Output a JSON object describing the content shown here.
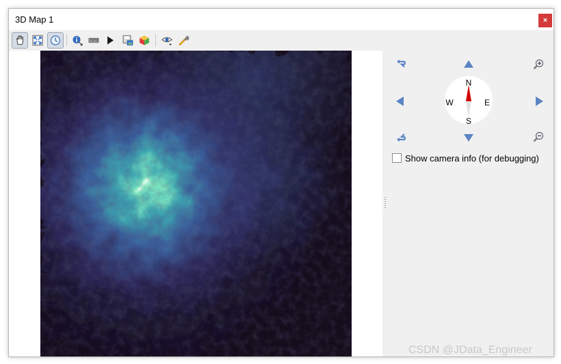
{
  "window": {
    "title": "3D Map 1",
    "close_glyph": "×"
  },
  "toolbar": {
    "tools": [
      {
        "icon": "pan-hand-icon",
        "active": true
      },
      {
        "icon": "zoom-full-icon"
      },
      {
        "icon": "camera-orbit-icon",
        "active": true
      },
      {
        "icon": "identify-icon"
      },
      {
        "icon": "measure-line-icon"
      },
      {
        "icon": "play-animation-icon"
      },
      {
        "icon": "save-image-icon"
      },
      {
        "icon": "export-3d-scene-icon"
      },
      {
        "icon": "view-options-icon"
      },
      {
        "icon": "configure-icon"
      }
    ]
  },
  "navigation": {
    "compass": {
      "north": "N",
      "south": "S",
      "east": "E",
      "west": "W"
    },
    "buttons": [
      "rotate-left-icon",
      "move-up-icon",
      "zoom-in-icon",
      "move-left-icon",
      "move-right-icon",
      "rotate-right-icon",
      "move-down-icon",
      "zoom-out-icon"
    ]
  },
  "camera_info": {
    "label": "Show camera info (for debugging)",
    "checked": false
  },
  "watermark": "CSDN @JData_Engineer",
  "colors": {
    "close_button": "#d43a3a",
    "compass_needle": "#d40000",
    "nav_arrow": "#5b84c4",
    "terrain_low": "#150c1e",
    "terrain_high": "#f0fff0"
  }
}
